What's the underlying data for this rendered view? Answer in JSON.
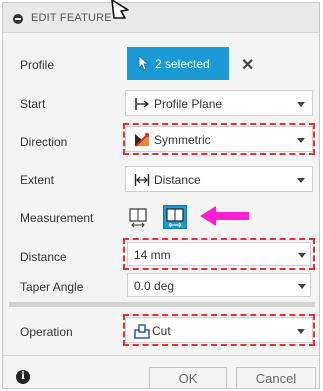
{
  "header": {
    "title": "EDIT FEATURE"
  },
  "rows": {
    "profile": {
      "label": "Profile",
      "value": "2 selected"
    },
    "start": {
      "label": "Start",
      "value": "Profile Plane"
    },
    "direction": {
      "label": "Direction",
      "value": "Symmetric"
    },
    "extent": {
      "label": "Extent",
      "value": "Distance"
    },
    "measurement": {
      "label": "Measurement"
    },
    "distance": {
      "label": "Distance",
      "value": "14 mm"
    },
    "taper": {
      "label": "Taper Angle",
      "value": "0.0 deg"
    },
    "operation": {
      "label": "Operation",
      "value": "Cut"
    }
  },
  "footer": {
    "ok_label": "OK",
    "cancel_label": "Cancel",
    "info_glyph": "i"
  },
  "colors": {
    "accent": "#1a9ad6",
    "highlight": "#e5303a",
    "pointer_arrow": "#ff1fd2"
  },
  "icons": [
    "close-icon",
    "cursor-icon",
    "plane-arrow-icon",
    "symmetric-icon",
    "distance-icon",
    "measure-icon",
    "cut-icon",
    "info-icon",
    "caret-down-icon"
  ]
}
